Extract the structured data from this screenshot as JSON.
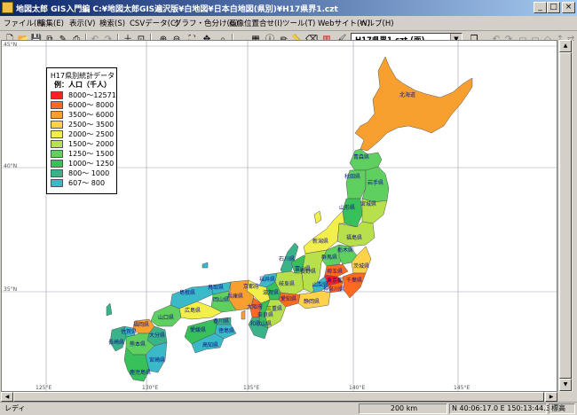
{
  "window": {
    "title": "地図太郎 GIS入門編  C:¥地図太郎GIS遍沢版¥白地図¥日本白地図(県別)¥H17県界1.czt",
    "minimize": "_",
    "maximize": "□",
    "close": "×"
  },
  "menu": [
    "ファイル(F)",
    "編集(E)",
    "表示(V)",
    "検索(S)",
    "CSVデータ(C)",
    "グラフ・色分け(G)",
    "画像位置合せ(I)",
    "ツール(T)",
    "Webサイト(W)",
    "ヘルプ(H)"
  ],
  "toolbar": {
    "icons": [
      "new-file-icon",
      "open-folder-icon",
      "save-icon",
      "copy-doc-icon",
      "edit-doc-icon",
      "print-icon",
      "undo-icon",
      "redo-icon",
      "add-icon",
      "frame-icon",
      "zoom-in-icon",
      "zoom-out-icon",
      "fit-window-icon",
      "pan-icon",
      "binoculars-icon",
      "table-icon",
      "info-icon",
      "pencil-icon",
      "ruler-icon",
      "eraser-icon",
      "chart-icon",
      "paint-icon"
    ],
    "layer_select": "H17県界1.czt (面)",
    "right_icons": [
      "layers-icon",
      "undo2-icon",
      "redo2-icon",
      "tool-a-icon",
      "tool-b-icon",
      "tool-c-icon",
      "tool-d-icon",
      "tool-e-icon"
    ]
  },
  "map": {
    "lat_labels": [
      "45°N",
      "40°N",
      "35°N"
    ],
    "lon_labels": [
      "125°E",
      "130°E",
      "135°E",
      "140°E",
      "145°E"
    ],
    "prefecture_labels": [
      "北海道",
      "青森県",
      "秋田県",
      "岩手県",
      "山形県",
      "宮城県",
      "新潟県",
      "福島県",
      "石川県",
      "富山県",
      "群馬県",
      "栃木県",
      "茨城県",
      "長野県",
      "福井県",
      "岐阜県",
      "山梨県",
      "埼玉県",
      "東京都",
      "千葉県",
      "神奈川県",
      "静岡県",
      "愛知県",
      "滋賀県",
      "京都府",
      "兵庫県",
      "大阪府",
      "奈良県",
      "三重県",
      "和歌山県",
      "鳥取県",
      "島根県",
      "岡山県",
      "広島県",
      "山口県",
      "香川県",
      "徳島県",
      "愛媛県",
      "高知県",
      "福岡県",
      "佐賀県",
      "長崎県",
      "大分県",
      "熊本県",
      "宮崎県",
      "鹿児島県"
    ],
    "colors": {
      "c1": "#ff2020",
      "c2": "#ff6a20",
      "c3": "#f7a030",
      "c4": "#ffd24a",
      "c5": "#f2ef4a",
      "c6": "#b7e04a",
      "c7": "#5fd05f",
      "c8": "#38c05a",
      "c9": "#3bb38a",
      "c10": "#3ab9c8"
    }
  },
  "legend": {
    "title": "H17県別統計データ",
    "subtitle": "例：人口（千人）",
    "rows": [
      {
        "label": "8000～12571",
        "color": "#ff2020"
      },
      {
        "label": "6000～ 8000",
        "color": "#ff6a20"
      },
      {
        "label": "3500～ 6000",
        "color": "#f7a030"
      },
      {
        "label": "2500～ 3500",
        "color": "#ffd24a"
      },
      {
        "label": "2000～ 2500",
        "color": "#f2ef4a"
      },
      {
        "label": "1500～ 2000",
        "color": "#b7e04a"
      },
      {
        "label": "1250～ 1500",
        "color": "#5fd05f"
      },
      {
        "label": "1000～ 1250",
        "color": "#38c05a"
      },
      {
        "label": "800～ 1000",
        "color": "#3bb38a"
      },
      {
        "label": "607～  800",
        "color": "#3ab9c8"
      }
    ]
  },
  "statusbar": {
    "ready": "レディ",
    "scale": "200 km",
    "coords": "N 40:06:17.0  E 150:13:44.3",
    "label": "標高"
  }
}
